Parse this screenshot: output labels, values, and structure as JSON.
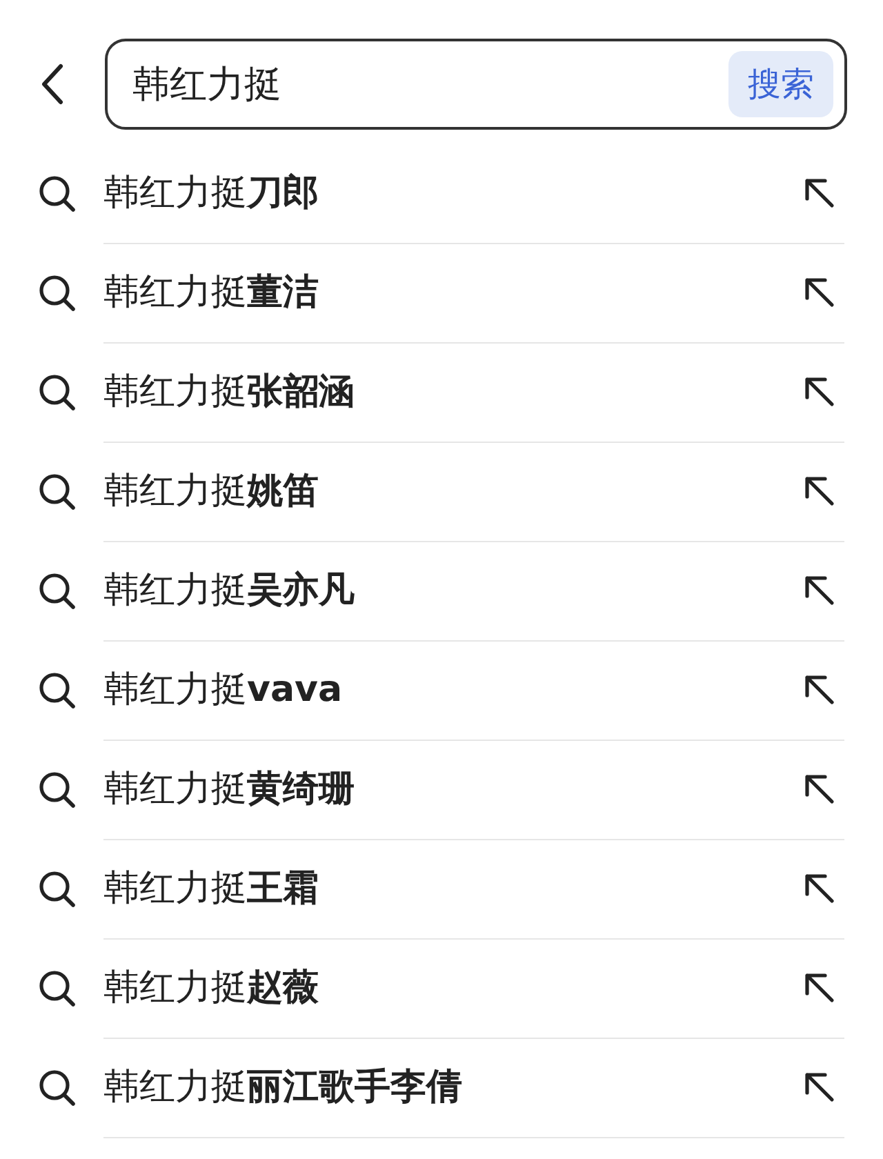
{
  "search": {
    "value": "韩红力挺",
    "button": "搜索"
  },
  "suggestions": [
    "韩红力挺**刀郎**",
    "韩红力挺**董洁**",
    "韩红力挺**张韶涵**",
    "韩红力挺**姚笛**",
    "韩红力挺**吴亦凡**",
    "韩红力挺**vava**",
    "韩红力挺**黄绮珊**",
    "韩红力挺**王霜**",
    "韩红力挺**赵薇**",
    "韩红力挺**丽江歌手李倩**"
  ]
}
